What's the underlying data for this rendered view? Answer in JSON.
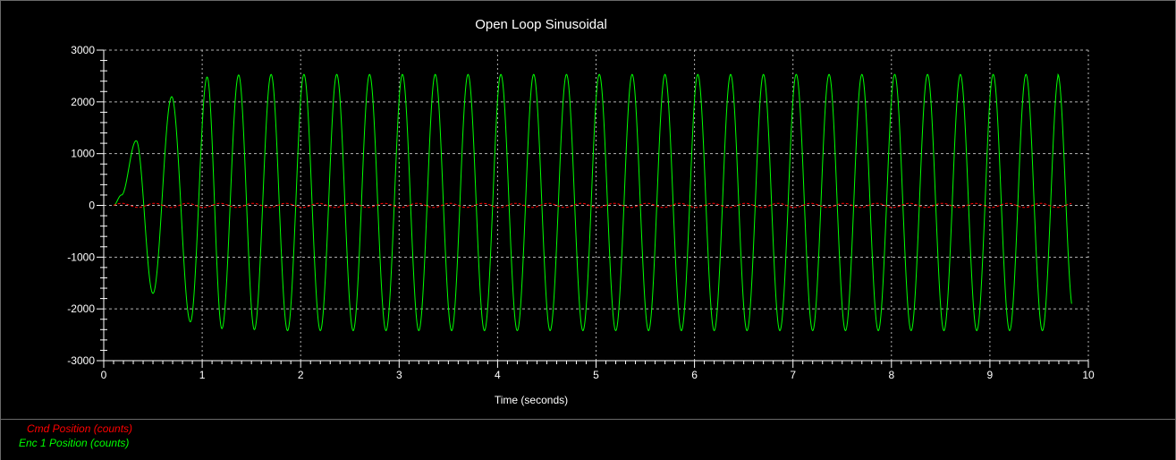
{
  "chart_data": {
    "type": "line",
    "title": "Open Loop Sinusoidal",
    "xlabel": "Time (seconds)",
    "ylabel": "",
    "xlim": [
      0,
      10
    ],
    "ylim": [
      -3000,
      3000
    ],
    "x_ticks": [
      0,
      1,
      2,
      3,
      4,
      5,
      6,
      7,
      8,
      9,
      10
    ],
    "y_ticks": [
      -3000,
      -2000,
      -1000,
      0,
      1000,
      2000,
      3000
    ],
    "grid": true,
    "legend_position": "bottom-left",
    "series": [
      {
        "name": "Cmd Position (counts)",
        "color": "#ff0000",
        "style": "dashed",
        "description_values": {
          "x_start": 0.1,
          "x_end": 9.83,
          "frequency_hz": 3.0,
          "amplitude": 40
        }
      },
      {
        "name": "Enc 1 Position (counts)",
        "color": "#00ff00",
        "style": "solid",
        "points": [
          [
            0.1,
            0
          ],
          [
            0.18,
            200
          ],
          [
            0.33,
            1250
          ],
          [
            0.5,
            -1700
          ],
          [
            0.69,
            2100
          ],
          [
            0.88,
            -2250
          ],
          [
            1.05,
            2480
          ],
          [
            1.2,
            -2380
          ],
          [
            1.37,
            2520
          ],
          [
            1.53,
            -2400
          ],
          [
            1.7,
            2530
          ],
          [
            9.69,
            2530
          ],
          [
            9.83,
            -1900
          ]
        ],
        "frequency_hz": 3.0,
        "steady_amplitude": 2500
      }
    ]
  },
  "legend": {
    "items": [
      {
        "label": "Cmd Position (counts)",
        "color": "#ff0000"
      },
      {
        "label": "Enc 1 Position (counts)",
        "color": "#00ff00"
      }
    ]
  }
}
